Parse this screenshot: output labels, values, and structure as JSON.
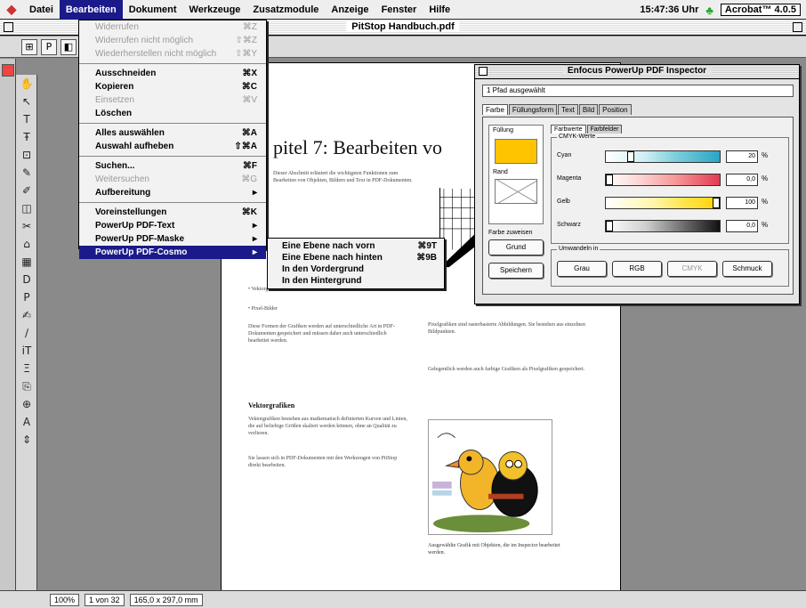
{
  "menubar": {
    "items": [
      "Datei",
      "Bearbeiten",
      "Dokument",
      "Werkzeuge",
      "Zusatzmodule",
      "Anzeige",
      "Fenster",
      "Hilfe"
    ],
    "active_index": 1,
    "clock": "15:47:36 Uhr",
    "app_name": "Acrobat™ 4.0.5"
  },
  "window": {
    "title": "PitStop Handbuch.pdf"
  },
  "edit_menu": {
    "groups": [
      [
        {
          "label": "Widerrufen",
          "shortcut": "⌘Z",
          "enabled": false
        },
        {
          "label": "Widerrufen nicht möglich",
          "shortcut": "⇧⌘Z",
          "enabled": false
        },
        {
          "label": "Wiederherstellen nicht möglich",
          "shortcut": "⇧⌘Y",
          "enabled": false
        }
      ],
      [
        {
          "label": "Ausschneiden",
          "shortcut": "⌘X",
          "enabled": true
        },
        {
          "label": "Kopieren",
          "shortcut": "⌘C",
          "enabled": true
        },
        {
          "label": "Einsetzen",
          "shortcut": "⌘V",
          "enabled": false
        },
        {
          "label": "Löschen",
          "shortcut": "",
          "enabled": true
        }
      ],
      [
        {
          "label": "Alles auswählen",
          "shortcut": "⌘A",
          "enabled": true
        },
        {
          "label": "Auswahl aufheben",
          "shortcut": "⇧⌘A",
          "enabled": true
        }
      ],
      [
        {
          "label": "Suchen...",
          "shortcut": "⌘F",
          "enabled": true
        },
        {
          "label": "Weitersuchen",
          "shortcut": "⌘G",
          "enabled": false
        },
        {
          "label": "Aufbereitung",
          "shortcut": "▸",
          "enabled": true
        }
      ],
      [
        {
          "label": "Voreinstellungen",
          "shortcut": "⌘K",
          "enabled": true
        },
        {
          "label": "PowerUp PDF-Text",
          "shortcut": "▸",
          "enabled": true
        },
        {
          "label": "PowerUp PDF-Maske",
          "shortcut": "▸",
          "enabled": true
        },
        {
          "label": "PowerUp PDF-Cosmo",
          "shortcut": "▸",
          "enabled": true,
          "highlighted": true
        }
      ]
    ]
  },
  "submenu": {
    "items": [
      {
        "label": "Eine Ebene nach vorn",
        "shortcut": "⌘9T"
      },
      {
        "label": "Eine Ebene nach hinten",
        "shortcut": "⌘9B"
      },
      {
        "label": "In den Vordergrund",
        "shortcut": ""
      },
      {
        "label": "In den Hintergrund",
        "shortcut": ""
      }
    ]
  },
  "toolbar": {
    "buttons": [
      "⊞",
      "P",
      "◧",
      "◧",
      "↶",
      "↷",
      "♫",
      "♣",
      "⚙",
      "◫",
      "◨"
    ]
  },
  "tools": [
    "✋",
    "↖",
    "T",
    "Ŧ",
    "⊡",
    "✎",
    "✐",
    "◫",
    "✂",
    "⌂",
    "▦",
    "D",
    "P",
    "✍",
    "∕",
    "iT",
    "Ξ",
    "⎘",
    "⊕",
    "A",
    "⇕"
  ],
  "page": {
    "chapter_title": "pitel 7: Bearbeiten vo",
    "intro": "Dieser Abschnitt erläutert die wichtigsten Funktionen zum Bearbeiten von Objekten, Bildern und Text in PDF-Dokumenten.",
    "bullets": [
      "Vektorgrafiken",
      "Pixel-Bilder"
    ],
    "body1": "Diese Formen der Grafiken werden auf unterschiedliche Art in PDF-Dokumenten gespeichert und müssen daher auch unterschiedlich bearbeitet werden.",
    "section_heading": "Vektorgrafiken",
    "body2": "Vektorgrafiken bestehen aus mathematisch definierten Kurven und Linien, die auf beliebige Größen skaliert werden können, ohne an Qualität zu verlieren.",
    "body3": "Sie lassen sich in PDF-Dokumenten mit den Werkzeugen von PitStop direkt bearbeiten.",
    "right_col1": "Pixelgrafiken sind rasterbasierte Abbildungen. Sie bestehen aus einzelnen Bildpunkten.",
    "right_col2": "Gelegentlich werden auch farbige Grafiken als Pixelgrafiken gespeichert.",
    "caption": "Ausgewählte Grafik mit Objekten, die im Inspector bearbeitet werden."
  },
  "statusbar": {
    "zoom": "100%",
    "page": "1 von 32",
    "size": "165,0 x 297,0 mm"
  },
  "inspector": {
    "title": "Enfocus PowerUp PDF Inspector",
    "selection": "1 Pfad ausgewählt",
    "tabs": [
      "Farbe",
      "Füllungsform",
      "Text",
      "Bild",
      "Position"
    ],
    "active_tab": 0,
    "fill_label": "Füllung",
    "stroke_label": "Rand",
    "fill_color": "#ffc400",
    "left_group_label": "Farbe zuweisen",
    "left_buttons": [
      "Grund",
      "Speichern"
    ],
    "subtabs": [
      "Farbwerte",
      "Farbfelder"
    ],
    "active_subtab": 0,
    "sliders_group": "CMYK-Werte",
    "sliders": [
      {
        "name": "Cyan",
        "value": "20",
        "percent": 0.2,
        "gradient": "linear-gradient(90deg,#ffffff,#cdeef4 35%,#7fd0dd 60%,#2aa5c6)"
      },
      {
        "name": "Magenta",
        "value": "0,0",
        "percent": 0.0,
        "gradient": "linear-gradient(90deg,#ffffff,#fbd4d4 30%,#f79a9a 60%,#e23a52)"
      },
      {
        "name": "Gelb",
        "value": "100",
        "percent": 1.0,
        "gradient": "linear-gradient(90deg,#ffffff,#fff7b0 40%,#ffe44a 70%,#ffd400)"
      },
      {
        "name": "Schwarz",
        "value": "0,0",
        "percent": 0.0,
        "gradient": "linear-gradient(90deg,#ffffff,#cfcfcf 35%,#777777 65%,#111111)"
      }
    ],
    "convert_group": "Umwandeln in",
    "convert_buttons": [
      {
        "label": "Grau",
        "enabled": true
      },
      {
        "label": "RGB",
        "enabled": true
      },
      {
        "label": "CMYK",
        "enabled": false
      },
      {
        "label": "Schmuck",
        "enabled": true
      }
    ]
  }
}
